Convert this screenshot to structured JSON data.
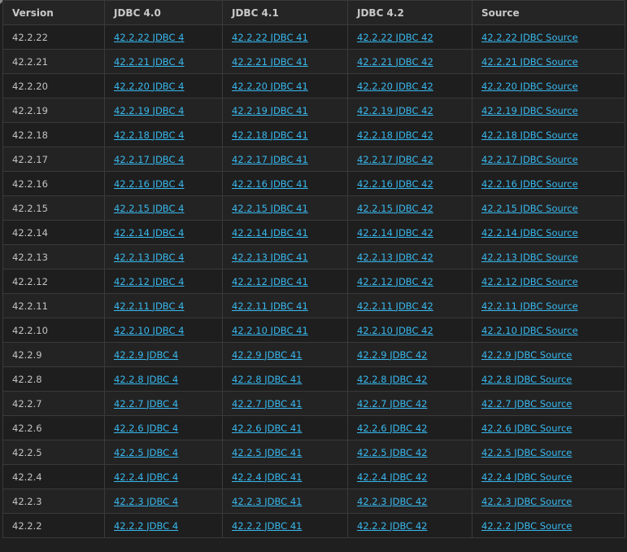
{
  "table": {
    "headers": [
      "Version",
      "JDBC 4.0",
      "JDBC 4.1",
      "JDBC 4.2",
      "Source"
    ],
    "rows": [
      {
        "version": "42.2.22",
        "jdbc40": "42.2.22 JDBC 4",
        "jdbc41": "42.2.22 JDBC 41",
        "jdbc42": "42.2.22 JDBC 42",
        "source": "42.2.22 JDBC Source"
      },
      {
        "version": "42.2.21",
        "jdbc40": "42.2.21 JDBC 4",
        "jdbc41": "42.2.21 JDBC 41",
        "jdbc42": "42.2.21 JDBC 42",
        "source": "42.2.21 JDBC Source"
      },
      {
        "version": "42.2.20",
        "jdbc40": "42.2.20 JDBC 4",
        "jdbc41": "42.2.20 JDBC 41",
        "jdbc42": "42.2.20 JDBC 42",
        "source": "42.2.20 JDBC Source"
      },
      {
        "version": "42.2.19",
        "jdbc40": "42.2.19 JDBC 4",
        "jdbc41": "42.2.19 JDBC 41",
        "jdbc42": "42.2.19 JDBC 42",
        "source": "42.2.19 JDBC Source"
      },
      {
        "version": "42.2.18",
        "jdbc40": "42.2.18 JDBC 4",
        "jdbc41": "42.2.18 JDBC 41",
        "jdbc42": "42.2.18 JDBC 42",
        "source": "42.2.18 JDBC Source"
      },
      {
        "version": "42.2.17",
        "jdbc40": "42.2.17 JDBC 4",
        "jdbc41": "42.2.17 JDBC 41",
        "jdbc42": "42.2.17 JDBC 42",
        "source": "42.2.17 JDBC Source"
      },
      {
        "version": "42.2.16",
        "jdbc40": "42.2.16 JDBC 4",
        "jdbc41": "42.2.16 JDBC 41",
        "jdbc42": "42.2.16 JDBC 42",
        "source": "42.2.16 JDBC Source"
      },
      {
        "version": "42.2.15",
        "jdbc40": "42.2.15 JDBC 4",
        "jdbc41": "42.2.15 JDBC 41",
        "jdbc42": "42.2.15 JDBC 42",
        "source": "42.2.15 JDBC Source"
      },
      {
        "version": "42.2.14",
        "jdbc40": "42.2.14 JDBC 4",
        "jdbc41": "42.2.14 JDBC 41",
        "jdbc42": "42.2.14 JDBC 42",
        "source": "42.2.14 JDBC Source"
      },
      {
        "version": "42.2.13",
        "jdbc40": "42.2.13 JDBC 4",
        "jdbc41": "42.2.13 JDBC 41",
        "jdbc42": "42.2.13 JDBC 42",
        "source": "42.2.13 JDBC Source"
      },
      {
        "version": "42.2.12",
        "jdbc40": "42.2.12 JDBC 4",
        "jdbc41": "42.2.12 JDBC 41",
        "jdbc42": "42.2.12 JDBC 42",
        "source": "42.2.12 JDBC Source"
      },
      {
        "version": "42.2.11",
        "jdbc40": "42.2.11 JDBC 4",
        "jdbc41": "42.2.11 JDBC 41",
        "jdbc42": "42.2.11 JDBC 42",
        "source": "42.2.11 JDBC Source"
      },
      {
        "version": "42.2.10",
        "jdbc40": "42.2.10 JDBC 4",
        "jdbc41": "42.2.10 JDBC 41",
        "jdbc42": "42.2.10 JDBC 42",
        "source": "42.2.10 JDBC Source"
      },
      {
        "version": "42.2.9",
        "jdbc40": "42.2.9 JDBC 4",
        "jdbc41": "42.2.9 JDBC 41",
        "jdbc42": "42.2.9 JDBC 42",
        "source": "42.2.9 JDBC Source"
      },
      {
        "version": "42.2.8",
        "jdbc40": "42.2.8 JDBC 4",
        "jdbc41": "42.2.8 JDBC 41",
        "jdbc42": "42.2.8 JDBC 42",
        "source": "42.2.8 JDBC Source"
      },
      {
        "version": "42.2.7",
        "jdbc40": "42.2.7 JDBC 4",
        "jdbc41": "42.2.7 JDBC 41",
        "jdbc42": "42.2.7 JDBC 42",
        "source": "42.2.7 JDBC Source"
      },
      {
        "version": "42.2.6",
        "jdbc40": "42.2.6 JDBC 4",
        "jdbc41": "42.2.6 JDBC 41",
        "jdbc42": "42.2.6 JDBC 42",
        "source": "42.2.6 JDBC Source"
      },
      {
        "version": "42.2.5",
        "jdbc40": "42.2.5 JDBC 4",
        "jdbc41": "42.2.5 JDBC 41",
        "jdbc42": "42.2.5 JDBC 42",
        "source": "42.2.5 JDBC Source"
      },
      {
        "version": "42.2.4",
        "jdbc40": "42.2.4 JDBC 4",
        "jdbc41": "42.2.4 JDBC 41",
        "jdbc42": "42.2.4 JDBC 42",
        "source": "42.2.4 JDBC Source"
      },
      {
        "version": "42.2.3",
        "jdbc40": "42.2.3 JDBC 4",
        "jdbc41": "42.2.3 JDBC 41",
        "jdbc42": "42.2.3 JDBC 42",
        "source": "42.2.3 JDBC Source"
      },
      {
        "version": "42.2.2",
        "jdbc40": "42.2.2 JDBC 4",
        "jdbc41": "42.2.2 JDBC 41",
        "jdbc42": "42.2.2 JDBC 42",
        "source": "42.2.2 JDBC Source"
      }
    ]
  },
  "colors": {
    "link": "#38b8ee",
    "background": "#1e1e1e",
    "row_alt": "#232323",
    "border": "#3a3a3a",
    "text": "#c3c3c3"
  }
}
